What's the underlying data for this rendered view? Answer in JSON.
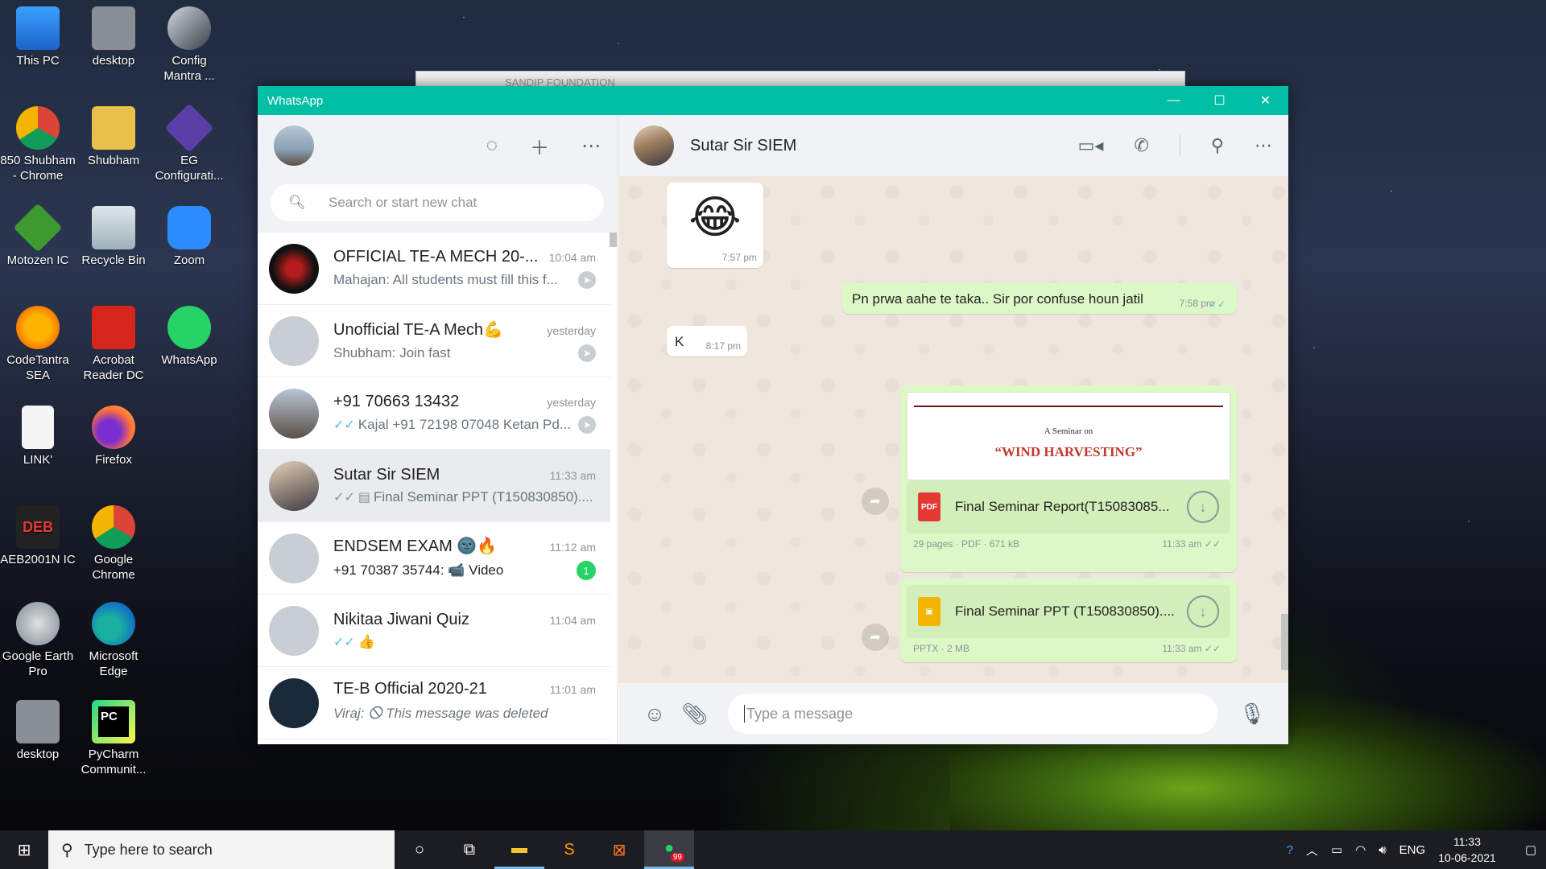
{
  "desktop": {
    "icons": [
      {
        "label": "This PC"
      },
      {
        "label": "desktop"
      },
      {
        "label": "Config Mantra ..."
      },
      {
        "label": "850 Shubham - Chrome"
      },
      {
        "label": "Shubham"
      },
      {
        "label": "EG Configurati..."
      },
      {
        "label": "Motozen IC"
      },
      {
        "label": "Recycle Bin"
      },
      {
        "label": "Zoom"
      },
      {
        "label": "CodeTantra SEA"
      },
      {
        "label": "Acrobat Reader DC"
      },
      {
        "label": "WhatsApp"
      },
      {
        "label": "LINK'"
      },
      {
        "label": "Firefox"
      },
      {
        "label": "AEB2001N IC"
      },
      {
        "label": "Google Chrome"
      },
      {
        "label": "Google Earth Pro"
      },
      {
        "label": "Microsoft Edge"
      },
      {
        "label": "desktop"
      },
      {
        "label": "PyCharm Communit..."
      }
    ],
    "behind_window_title": "SANDIP FOUNDATION"
  },
  "window": {
    "title": "WhatsApp",
    "accent": "#00bfa5"
  },
  "sidebar": {
    "search_placeholder": "Search or start new chat",
    "chats": [
      {
        "name": "OFFICIAL TE-A MECH 20-...",
        "time": "10:04 am",
        "preview": "Mahajan: All students must fill this f..."
      },
      {
        "name": "Unofficial TE-A Mech💪",
        "time": "yesterday",
        "preview": "Shubham: Join fast"
      },
      {
        "name": "+91 70663 13432",
        "time": "yesterday",
        "preview": "Kajal +91 72198 07048 Ketan Pd..."
      },
      {
        "name": "Sutar Sir SIEM",
        "time": "11:33 am",
        "preview": "Final Seminar PPT (T150830850)...."
      },
      {
        "name": "ENDSEM EXAM 🌚🔥",
        "time": "11:12 am",
        "preview": "+91 70387 35744: 📹 Video",
        "unread": "1"
      },
      {
        "name": "Nikitaa Jiwani Quiz",
        "time": "11:04 am",
        "preview": "👍"
      },
      {
        "name": "TE-B Official 2020-21",
        "time": "11:01 am",
        "preview": "Viraj: 🛇 This message was deleted"
      }
    ]
  },
  "conversation": {
    "contact": "Sutar Sir SIEM",
    "messages": {
      "emoji": {
        "text": "😂",
        "time": "7:57 pm"
      },
      "out1": {
        "text": "Pn prwa aahe te taka.. Sir por confuse houn jatil",
        "time": "7:58 pm"
      },
      "in1": {
        "text": "K",
        "time": "8:17 pm"
      },
      "doc1": {
        "preview_line1": "A Seminar on",
        "preview_line2": "“WIND HARVESTING”",
        "icon": "PDF",
        "name": "Final Seminar Report(T15083085...",
        "meta": "29 pages · PDF · 671 kB",
        "time": "11:33 am"
      },
      "doc2": {
        "name": "Final Seminar PPT (T150830850)....",
        "meta": "PPTX · 2 MB",
        "time": "11:33 am"
      }
    },
    "compose_placeholder": "Type a message"
  },
  "taskbar": {
    "search_placeholder": "Type here to search",
    "badge": "99",
    "lang": "ENG",
    "time": "11:33",
    "date": "10-06-2021"
  }
}
